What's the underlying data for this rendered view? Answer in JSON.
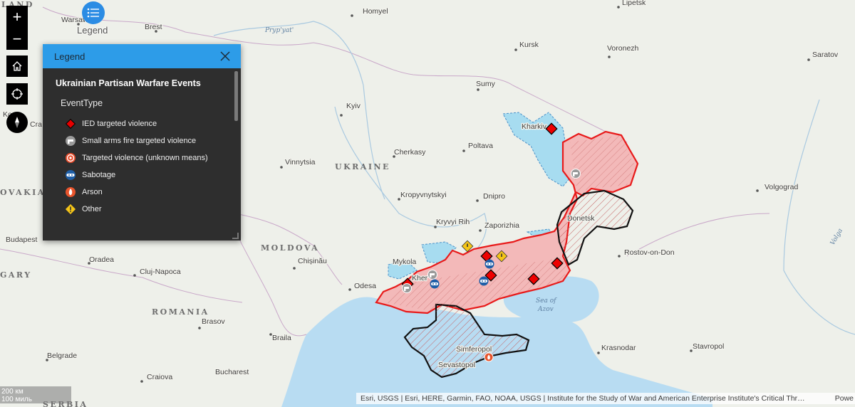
{
  "legend_toggle": {
    "label": "Legend"
  },
  "legend": {
    "title": "Legend",
    "layer_title": "Ukrainian Partisan Warfare Events",
    "field_label": "EventType",
    "items": [
      {
        "label": "IED targeted violence",
        "icon": "ied-diamond-icon",
        "color": "#e60000"
      },
      {
        "label": "Small arms fire targeted violence",
        "icon": "pistol-icon",
        "color": "#9a9a9a"
      },
      {
        "label": "Targeted violence (unknown means)",
        "icon": "target-icon",
        "color": "#e84d2c"
      },
      {
        "label": "Sabotage",
        "icon": "mask-icon",
        "color": "#1f5fa8"
      },
      {
        "label": "Arson",
        "icon": "fire-icon",
        "color": "#e8542c"
      },
      {
        "label": "Other",
        "icon": "warning-diamond-icon",
        "color": "#f5c518"
      }
    ]
  },
  "map": {
    "country_labels": {
      "ukraine": "UKRAINE",
      "moldova": "MOLDOVA",
      "romania": "ROMANIA",
      "slovakia": "OVAKIA",
      "hungary": "GARY",
      "poland": "LAND",
      "serbia": "SERBIA"
    },
    "cities": {
      "warsaw": "Warsaw",
      "brest": "Brest",
      "homyel": "Homyel",
      "lipetsk": "Lipetsk",
      "kursk": "Kursk",
      "voronezh": "Voronezh",
      "saratov": "Saratov",
      "sumy": "Sumy",
      "kyiv": "Kyiv",
      "kharkiv": "Kharkiv",
      "poltava": "Poltava",
      "cherkasy": "Cherkasy",
      "vinnytsia": "Vinnytsia",
      "volgograd": "Volgograd",
      "kropyvnytskyi": "Kropyvnytskyi",
      "dnipro": "Dnipro",
      "donetsk": "Donetsk",
      "kryvyi_rih": "Kryvyi Rih",
      "zaporizhia": "Zaporizhia",
      "rostov": "Rostov-on-Don",
      "mykolaiv": "Mykola",
      "kherson": "Kher",
      "chisinau": "Chișinău",
      "odesa": "Odesa",
      "oradea": "Oradea",
      "cluj": "Cluj-Napoca",
      "budapest": "Budapest",
      "brasov": "Brasov",
      "braila": "Braila",
      "krasnodar": "Krasnodar",
      "stavropol": "Stavropol",
      "simferopol": "Simferopol",
      "sevastopol": "Sevastopol",
      "belgrade": "Belgrade",
      "craiova": "Craiova",
      "bucharest": "Bucharest",
      "kosice": "Ko",
      "cra": "Cra"
    },
    "water_labels": {
      "pripyat": "Pryp'yat'",
      "sea_of_azov_1": "Sea of",
      "sea_of_azov_2": "Azov",
      "volga": "Volga"
    }
  },
  "attribution": "Esri, USGS | Esri, HERE, Garmin, FAO, NOAA, USGS | Institute for the Study of War and American Enterprise Institute's Critical Thr…",
  "powered": "Powe",
  "scale": {
    "km": "200 км",
    "mi": "100 миль"
  }
}
